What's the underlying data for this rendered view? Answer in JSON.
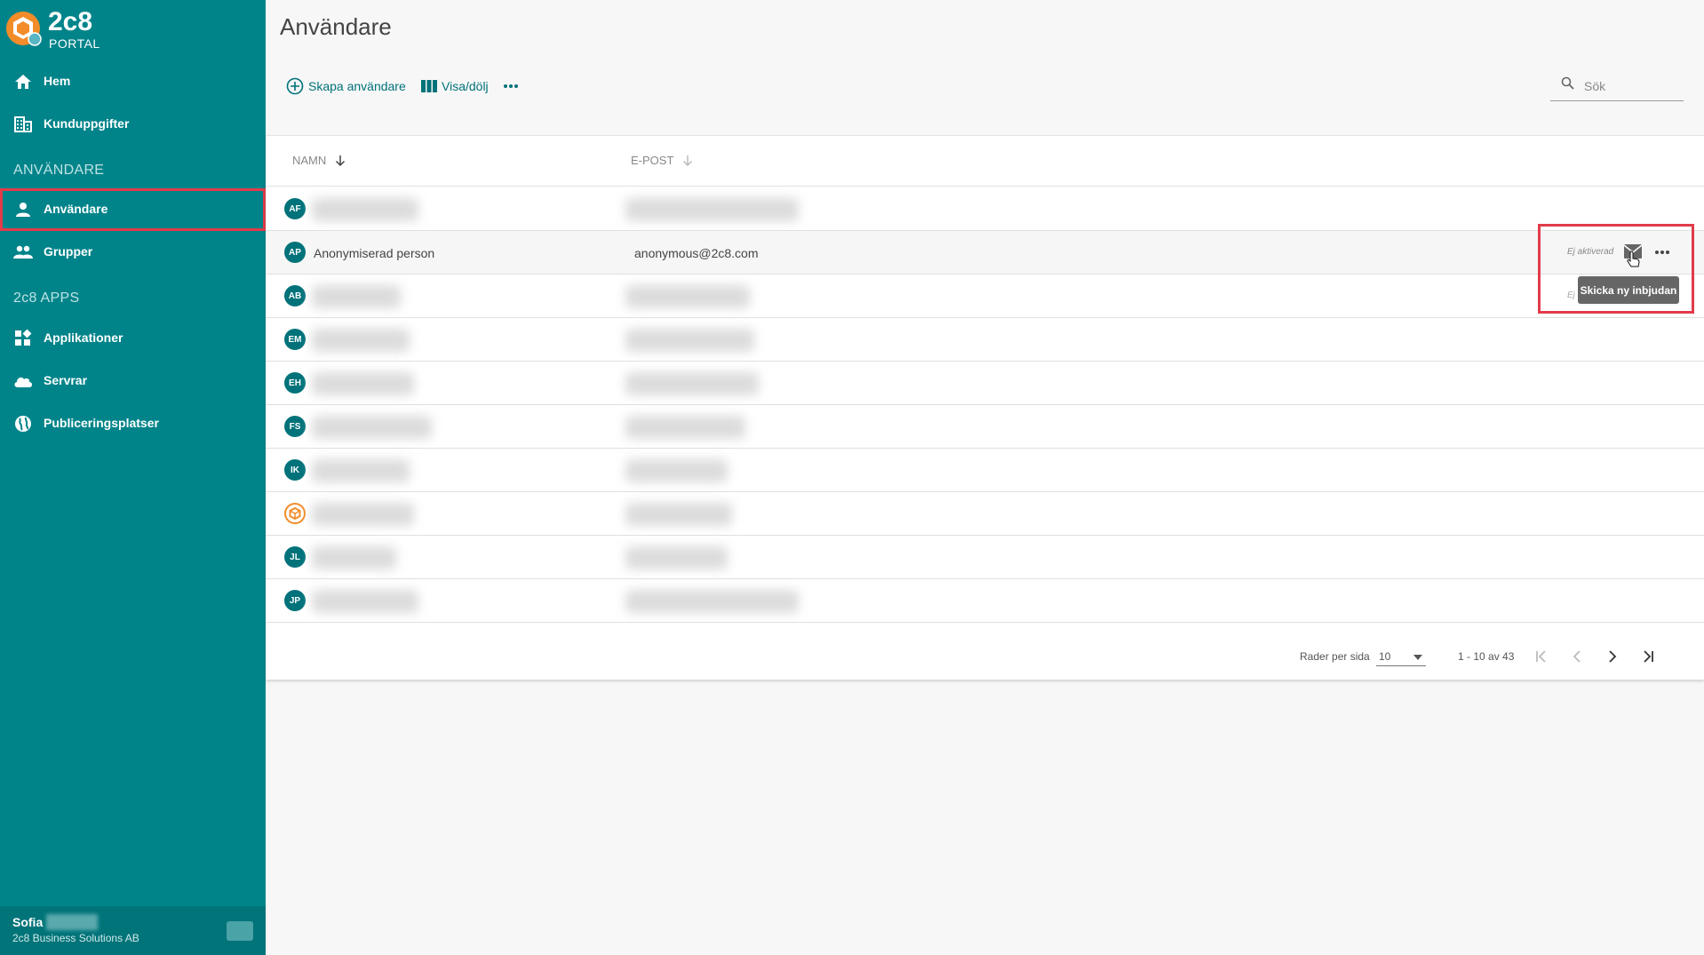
{
  "app": {
    "logo_title": "2c8",
    "logo_subtitle": "PORTAL",
    "brand_color": "#00848a",
    "accent_color": "#f28c28"
  },
  "sidebar": {
    "items": [
      {
        "label": "Hem",
        "icon": "home-icon"
      },
      {
        "label": "Kunduppgifter",
        "icon": "building-icon"
      }
    ],
    "section_users": "ANVÄNDARE",
    "user_items": [
      {
        "label": "Användare",
        "icon": "person-icon",
        "active": true
      },
      {
        "label": "Grupper",
        "icon": "people-icon"
      }
    ],
    "section_apps": "2c8 APPS",
    "app_items": [
      {
        "label": "Applikationer",
        "icon": "widgets-icon"
      },
      {
        "label": "Servrar",
        "icon": "cloud-icon"
      },
      {
        "label": "Publiceringsplatser",
        "icon": "globe-icon"
      }
    ],
    "user": {
      "name": "Sofia",
      "company": "2c8 Business Solutions AB"
    }
  },
  "main": {
    "title": "Användare",
    "toolbar": {
      "create_label": "Skapa användare",
      "toggle_label": "Visa/dölj"
    },
    "search": {
      "placeholder": "Sök"
    },
    "table": {
      "columns": {
        "name": "NAMN",
        "email": "E-POST"
      },
      "rows": [
        {
          "initials": "AF"
        },
        {
          "initials": "AP",
          "name": "Anonymiserad person",
          "email": "anonymous@2c8.com",
          "status": "Ej aktiverad"
        },
        {
          "initials": "AB",
          "status": "Ej"
        },
        {
          "initials": "EM"
        },
        {
          "initials": "EH"
        },
        {
          "initials": "FS"
        },
        {
          "initials": "IK"
        },
        {
          "initials": ""
        },
        {
          "initials": "JL"
        },
        {
          "initials": "JP"
        }
      ],
      "tooltip": "Skicka ny inbjudan"
    },
    "pagination": {
      "rows_per_page_label": "Rader per sida",
      "rows_per_page_value": "10",
      "range": "1 - 10 av 43"
    }
  }
}
